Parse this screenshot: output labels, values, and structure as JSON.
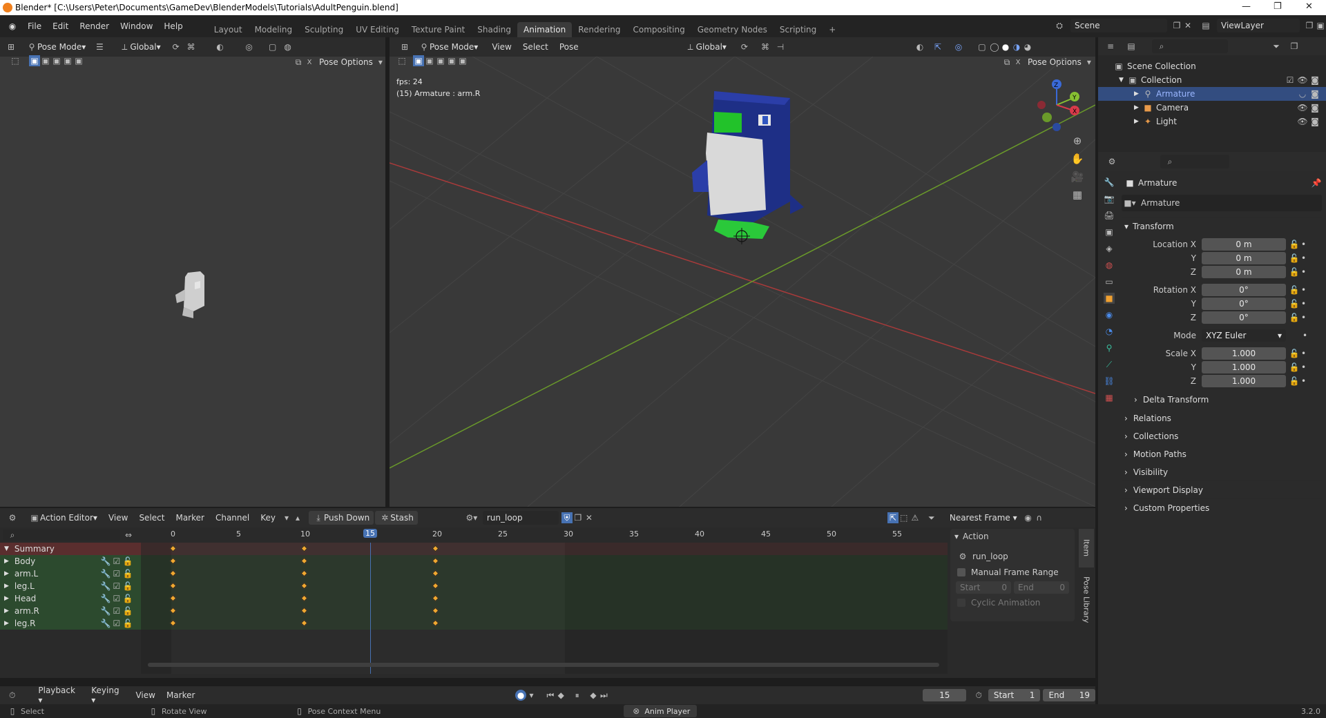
{
  "titlebar": {
    "title": "Blender* [C:\\Users\\Peter\\Documents\\GameDev\\BlenderModels\\Tutorials\\AdultPenguin.blend]"
  },
  "menu": [
    "File",
    "Edit",
    "Render",
    "Window",
    "Help"
  ],
  "workspaces": [
    "Layout",
    "Modeling",
    "Sculpting",
    "UV Editing",
    "Texture Paint",
    "Shading",
    "Animation",
    "Rendering",
    "Compositing",
    "Geometry Nodes",
    "Scripting"
  ],
  "active_workspace": "Animation",
  "scene": {
    "label": "Scene",
    "viewlayer": "ViewLayer"
  },
  "left_vp": {
    "mode": "Pose Mode",
    "orientation": "Global",
    "pose_options": "Pose Options"
  },
  "main_vp": {
    "mode": "Pose Mode",
    "menus": [
      "View",
      "Select",
      "Pose"
    ],
    "orientation": "Global",
    "pose_options": "Pose Options",
    "fps": "fps: 24",
    "info": "(15) Armature : arm.R"
  },
  "outliner": {
    "root": "Scene Collection",
    "collection": "Collection",
    "items": [
      {
        "label": "Armature",
        "selected": true
      },
      {
        "label": "Camera",
        "selected": false
      },
      {
        "label": "Light",
        "selected": false
      }
    ]
  },
  "properties": {
    "object": "Armature",
    "datablock": "Armature",
    "transform_label": "Transform",
    "location": {
      "label_x": "Location X",
      "x": "0 m",
      "y": "0 m",
      "z": "0 m"
    },
    "rotation": {
      "label_x": "Rotation X",
      "x": "0°",
      "y": "0°",
      "z": "0°"
    },
    "mode_label": "Mode",
    "mode": "XYZ Euler",
    "scale": {
      "label_x": "Scale X",
      "x": "1.000",
      "y": "1.000",
      "z": "1.000"
    },
    "axis_y": "Y",
    "axis_z": "Z",
    "delta": "Delta Transform",
    "panels": [
      "Relations",
      "Collections",
      "Motion Paths",
      "Visibility",
      "Viewport Display",
      "Custom Properties"
    ]
  },
  "action_editor": {
    "mode": "Action Editor",
    "menus": [
      "View",
      "Select",
      "Marker",
      "Channel",
      "Key"
    ],
    "push_down": "Push Down",
    "stash": "Stash",
    "action": "run_loop",
    "snap": "Nearest Frame",
    "ruler": [
      "0",
      "5",
      "10",
      "15",
      "20",
      "25",
      "30",
      "35",
      "40",
      "45",
      "50",
      "55"
    ],
    "current_frame": "15",
    "channels": [
      "Summary",
      "Body",
      "arm.L",
      "leg.L",
      "Head",
      "arm.R",
      "leg.R"
    ],
    "keyframes": [
      0,
      10,
      20
    ]
  },
  "action_panel": {
    "header": "Action",
    "name": "run_loop",
    "manual_range": "Manual Frame Range",
    "start_label": "Start",
    "start": "0",
    "end_label": "End",
    "end": "0",
    "cyclic": "Cyclic Animation",
    "tab_item": "Item",
    "tab_pose_library": "Pose Library"
  },
  "timeline": {
    "menus": [
      "Playback",
      "Keying",
      "View",
      "Marker"
    ],
    "frame": "15",
    "start_label": "Start",
    "start": "1",
    "end_label": "End",
    "end": "19"
  },
  "statusbar": {
    "select": "Select",
    "rotate": "Rotate View",
    "context": "Pose Context Menu",
    "anim": "Anim Player",
    "version": "3.2.0"
  }
}
